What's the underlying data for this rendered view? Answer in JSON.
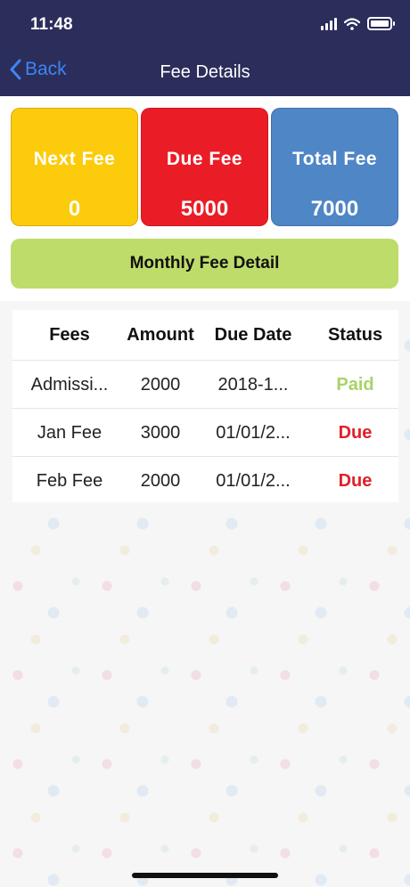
{
  "status_bar": {
    "time": "11:48"
  },
  "nav": {
    "back_label": "Back",
    "title": "Fee Details"
  },
  "summary_cards": [
    {
      "label": "Next Fee",
      "value": "0",
      "color": "#fccb0b"
    },
    {
      "label": "Due Fee",
      "value": "5000",
      "color": "#ea1d27"
    },
    {
      "label": "Total Fee",
      "value": "7000",
      "color": "#4f86c6"
    }
  ],
  "monthly_button": {
    "label": "Monthly Fee Detail",
    "color": "#bedc6a"
  },
  "table": {
    "columns": [
      "Fees",
      "Amount",
      "Due Date",
      "Status"
    ],
    "rows": [
      {
        "fees": "Admissi...",
        "amount": "2000",
        "due_date": "2018-1...",
        "status": "Paid"
      },
      {
        "fees": "Jan Fee",
        "amount": "3000",
        "due_date": "01/01/2...",
        "status": "Due"
      },
      {
        "fees": "Feb Fee",
        "amount": "2000",
        "due_date": "01/01/2...",
        "status": "Due"
      }
    ]
  },
  "colors": {
    "header_bg": "#2b2d5b",
    "back_link": "#3d86f4",
    "paid": "#a9d26a",
    "due": "#e0202a"
  },
  "icons": [
    "signal-icon",
    "wifi-icon",
    "battery-icon",
    "chevron-left-icon"
  ]
}
